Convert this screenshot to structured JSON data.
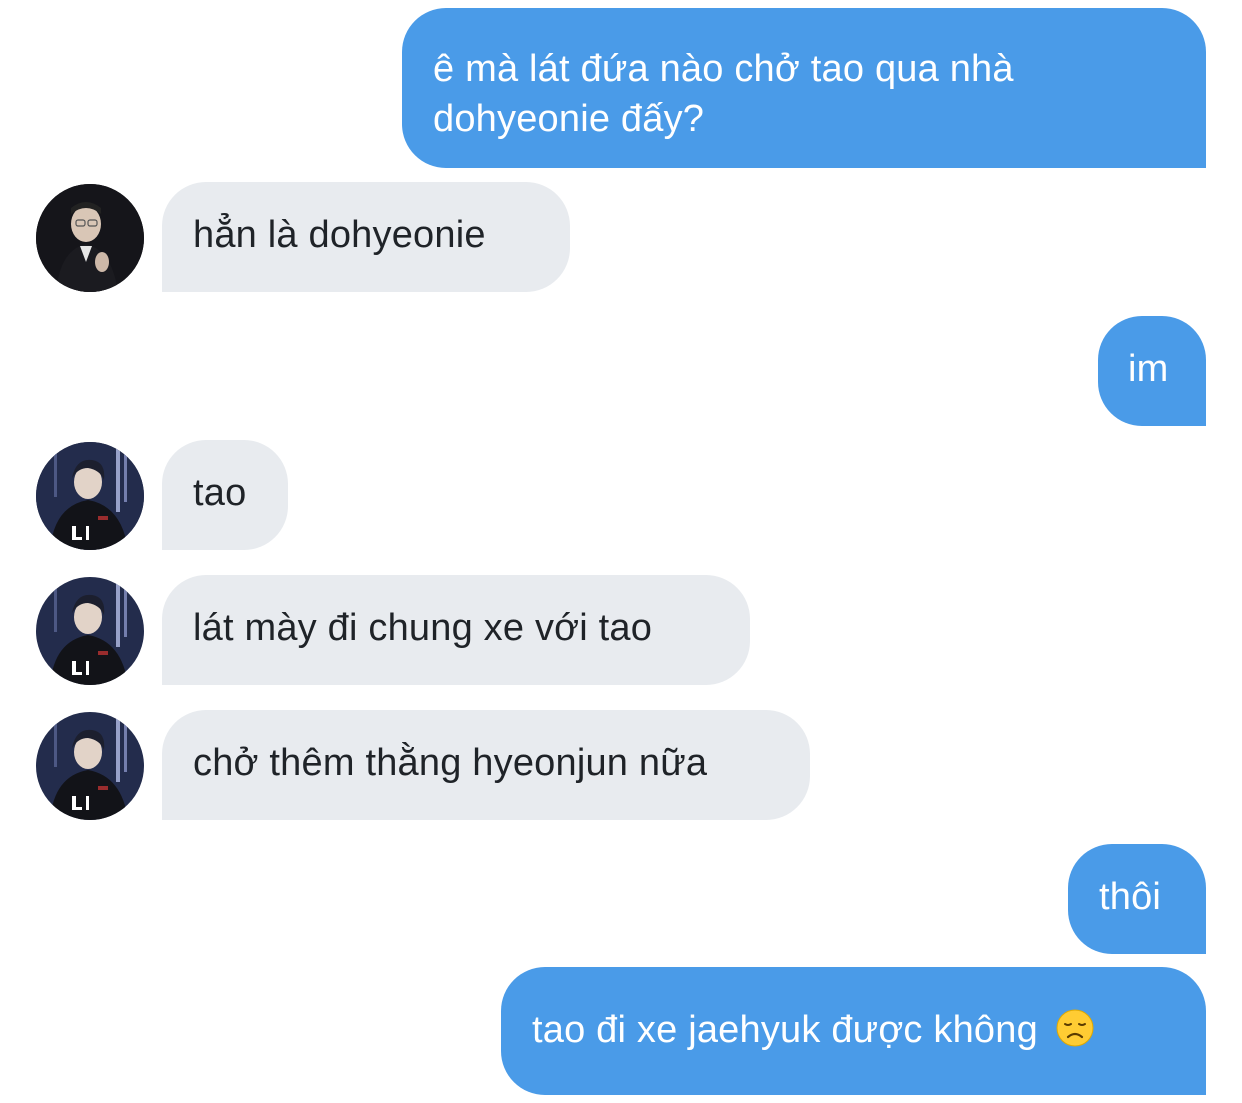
{
  "conversation": {
    "messages": [
      {
        "sender": "me",
        "text": "ê mà lát đứa nào chở tao qua nhà dohyeonie đấy?"
      },
      {
        "sender": "other",
        "text": "hẳn là dohyeonie",
        "avatar": "avatar-dark-suit"
      },
      {
        "sender": "me",
        "text": "im"
      },
      {
        "sender": "other",
        "text": "tao",
        "avatar": "avatar-team-jersey"
      },
      {
        "sender": "other",
        "text": "lát mày đi chung xe với tao",
        "avatar": "avatar-team-jersey"
      },
      {
        "sender": "other",
        "text": "chở thêm thằng hyeonjun nữa",
        "avatar": "avatar-team-jersey"
      },
      {
        "sender": "me",
        "text": "thôi"
      },
      {
        "sender": "me",
        "text": "tao đi xe jaehyuk được không",
        "emoji": "disappointed-face-icon"
      }
    ]
  },
  "colors": {
    "sent_bubble": "#4a9be8",
    "received_bubble": "#e8ebef",
    "sent_text": "#ffffff",
    "received_text": "#1f2328"
  }
}
